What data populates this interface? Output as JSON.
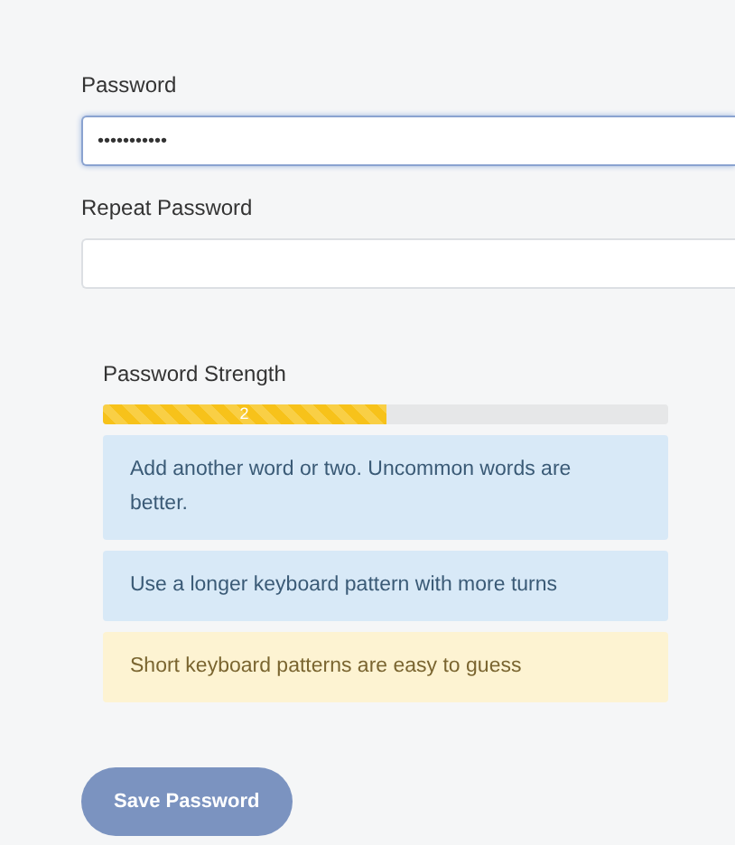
{
  "fields": [
    {
      "label": "Password",
      "value": "•••••••••••",
      "focused": true
    },
    {
      "label": "Repeat Password",
      "focused": false
    }
  ],
  "strength": {
    "title": "Password Strength",
    "level": 0.5,
    "score": "2"
  },
  "messages": [
    {
      "kind": "suggestion",
      "text": "Add another word or two. Uncommon words are better."
    },
    {
      "kind": "suggestion",
      "text": "Use a longer keyboard pattern with more turns"
    },
    {
      "kind": "warning",
      "text": "Short keyboard patterns are easy to guess"
    }
  ],
  "save_button": {
    "label": "Save Password",
    "disabled": true
  }
}
